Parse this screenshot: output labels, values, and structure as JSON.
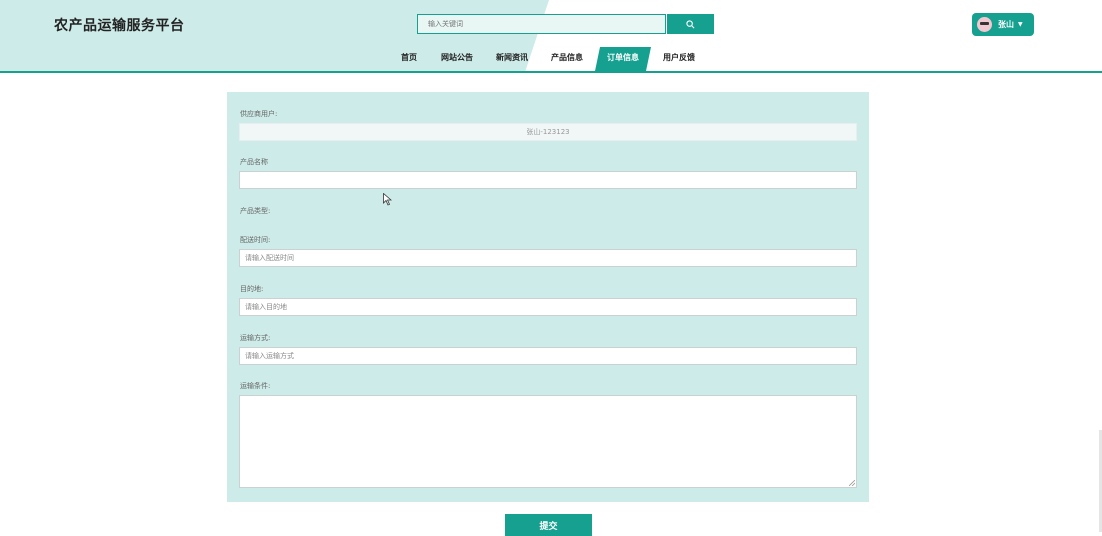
{
  "header": {
    "site_title": "农产品运输服务平台",
    "search": {
      "placeholder": "输入关键词",
      "icon": "search-icon"
    },
    "user": {
      "name": "张山",
      "icon": "avatar"
    },
    "nav": [
      "首页",
      "网站公告",
      "新闻资讯",
      "产品信息",
      "订单信息",
      "用户反馈"
    ],
    "nav_active": "订单信息"
  },
  "form": {
    "supplier_label": "供应商用户:",
    "supplier_value": "张山-123123",
    "product_name_label": "产品名称",
    "product_name_value": "",
    "product_type_label": "产品类型:",
    "delivery_time_label": "配送时间:",
    "delivery_time_placeholder": "请输入配送时间",
    "destination_label": "目的地:",
    "destination_placeholder": "请输入目的地",
    "transport_method_label": "运输方式:",
    "transport_method_placeholder": "请输入运输方式",
    "transport_conditions_label": "运输条件:",
    "submit_label": "提交"
  },
  "colors": {
    "accent": "#16a090",
    "panel": "#cdebe8",
    "header_tint": "#cdebe8"
  }
}
